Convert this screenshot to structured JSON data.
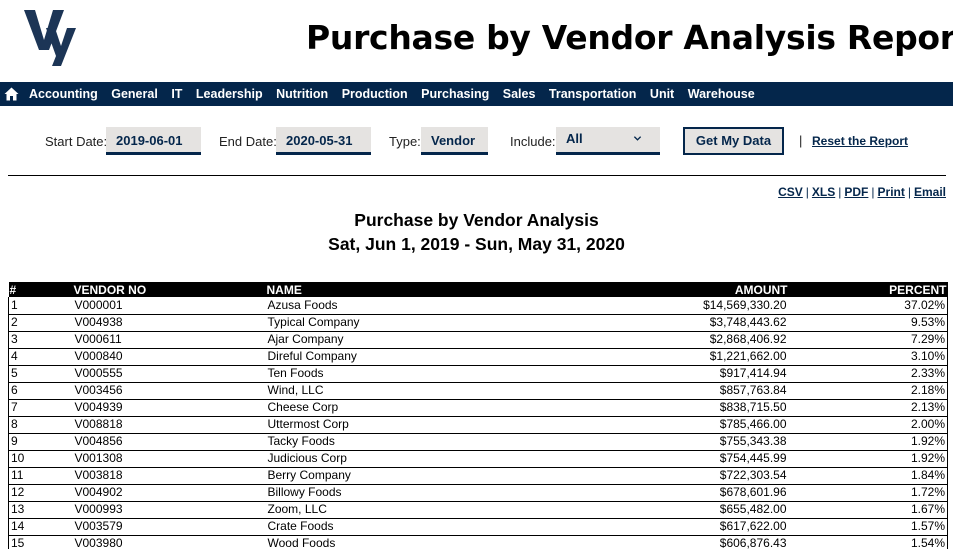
{
  "header": {
    "logo_text": "Vy",
    "title": "Purchase by Vendor Analysis Report"
  },
  "nav": {
    "home_icon": "home-icon",
    "items": [
      "Accounting",
      "General",
      "IT",
      "Leadership",
      "Nutrition",
      "Production",
      "Purchasing",
      "Sales",
      "Transportation",
      "Unit",
      "Warehouse"
    ]
  },
  "filters": {
    "start_date_label": "Start Date:",
    "start_date_value": "2019-06-01",
    "end_date_label": "End Date:",
    "end_date_value": "2020-05-31",
    "type_label": "Type:",
    "type_value": "Vendor",
    "include_label": "Include:",
    "include_value": "All",
    "get_data_label": "Get My Data",
    "separator": "|",
    "reset_label": "Reset the Report"
  },
  "exports": {
    "csv": "CSV",
    "xls": "XLS",
    "pdf": "PDF",
    "print": "Print",
    "email": "Email",
    "separator": "|"
  },
  "report": {
    "title": "Purchase by Vendor Analysis",
    "date_range": "Sat, Jun 1, 2019 - Sun, May 31, 2020"
  },
  "table": {
    "columns": [
      "#",
      "VENDOR NO",
      "NAME",
      "AMOUNT",
      "PERCENT"
    ],
    "rows": [
      [
        "1",
        "V000001",
        "Azusa Foods",
        "$14,569,330.20",
        "37.02%"
      ],
      [
        "2",
        "V004938",
        "Typical Company",
        "$3,748,443.62",
        "9.53%"
      ],
      [
        "3",
        "V000611",
        "Ajar Company",
        "$2,868,406.92",
        "7.29%"
      ],
      [
        "4",
        "V000840",
        "Direful Company",
        "$1,221,662.00",
        "3.10%"
      ],
      [
        "5",
        "V000555",
        "Ten Foods",
        "$917,414.94",
        "2.33%"
      ],
      [
        "6",
        "V003456",
        "Wind, LLC",
        "$857,763.84",
        "2.18%"
      ],
      [
        "7",
        "V004939",
        "Cheese Corp",
        "$838,715.50",
        "2.13%"
      ],
      [
        "8",
        "V008818",
        "Uttermost Corp",
        "$785,466.00",
        "2.00%"
      ],
      [
        "9",
        "V004856",
        "Tacky Foods",
        "$755,343.38",
        "1.92%"
      ],
      [
        "10",
        "V001308",
        "Judicious Corp",
        "$754,445.99",
        "1.92%"
      ],
      [
        "11",
        "V003818",
        "Berry Company",
        "$722,303.54",
        "1.84%"
      ],
      [
        "12",
        "V004902",
        "Billowy Foods",
        "$678,601.96",
        "1.72%"
      ],
      [
        "13",
        "V000993",
        "Zoom, LLC",
        "$655,482.00",
        "1.67%"
      ],
      [
        "14",
        "V003579",
        "Crate Foods",
        "$617,622.00",
        "1.57%"
      ],
      [
        "15",
        "V003980",
        "Wood Foods",
        "$606,876.43",
        "1.54%"
      ]
    ]
  },
  "colors": {
    "brand_navy": "#04264b",
    "input_bg": "#e5e3e1",
    "table_header_bg": "#000000"
  }
}
